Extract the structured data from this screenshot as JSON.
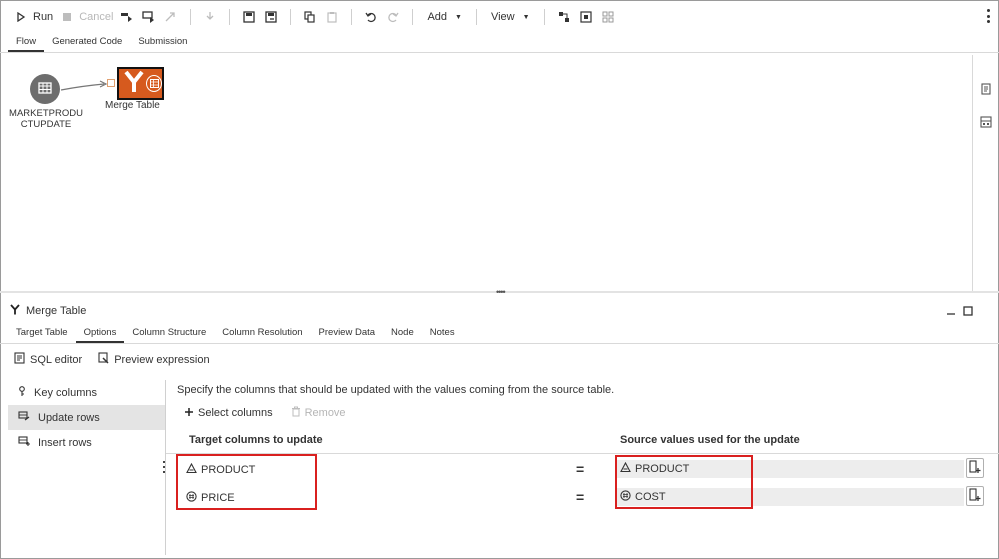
{
  "toolbar": {
    "run_label": "Run",
    "cancel_label": "Cancel",
    "add_label": "Add",
    "view_label": "View"
  },
  "top_tabs": [
    {
      "label": "Flow",
      "active": true
    },
    {
      "label": "Generated Code",
      "active": false
    },
    {
      "label": "Submission",
      "active": false
    }
  ],
  "flow": {
    "source_node_label": "MARKETPRODUCTUPDATE",
    "merge_node_label": "Merge Table"
  },
  "panel": {
    "title": "Merge Table",
    "tabs": [
      {
        "label": "Target Table"
      },
      {
        "label": "Options"
      },
      {
        "label": "Column Structure"
      },
      {
        "label": "Column Resolution"
      },
      {
        "label": "Preview Data"
      },
      {
        "label": "Node"
      },
      {
        "label": "Notes"
      }
    ],
    "active_tab": "Options",
    "actions": {
      "sql_editor": "SQL editor",
      "preview_expression": "Preview expression"
    },
    "nav": [
      {
        "label": "Key columns"
      },
      {
        "label": "Update rows"
      },
      {
        "label": "Insert rows"
      }
    ],
    "active_nav": "Update rows",
    "description": "Specify the columns that should be updated with the values coming from the source table.",
    "select_columns": "Select columns",
    "remove": "Remove",
    "target_header": "Target columns to update",
    "source_header": "Source values used for the update",
    "rows": [
      {
        "target": "PRODUCT",
        "target_type": "character-icon",
        "equals": "=",
        "source": "PRODUCT",
        "source_type": "character-icon"
      },
      {
        "target": "PRICE",
        "target_type": "numeric-icon",
        "equals": "=",
        "source": "COST",
        "source_type": "numeric-icon"
      }
    ]
  },
  "colors": {
    "accent_orange": "#d65a1e",
    "highlight_red": "#d9201f",
    "source_node_gray": "#6d6d6d"
  }
}
